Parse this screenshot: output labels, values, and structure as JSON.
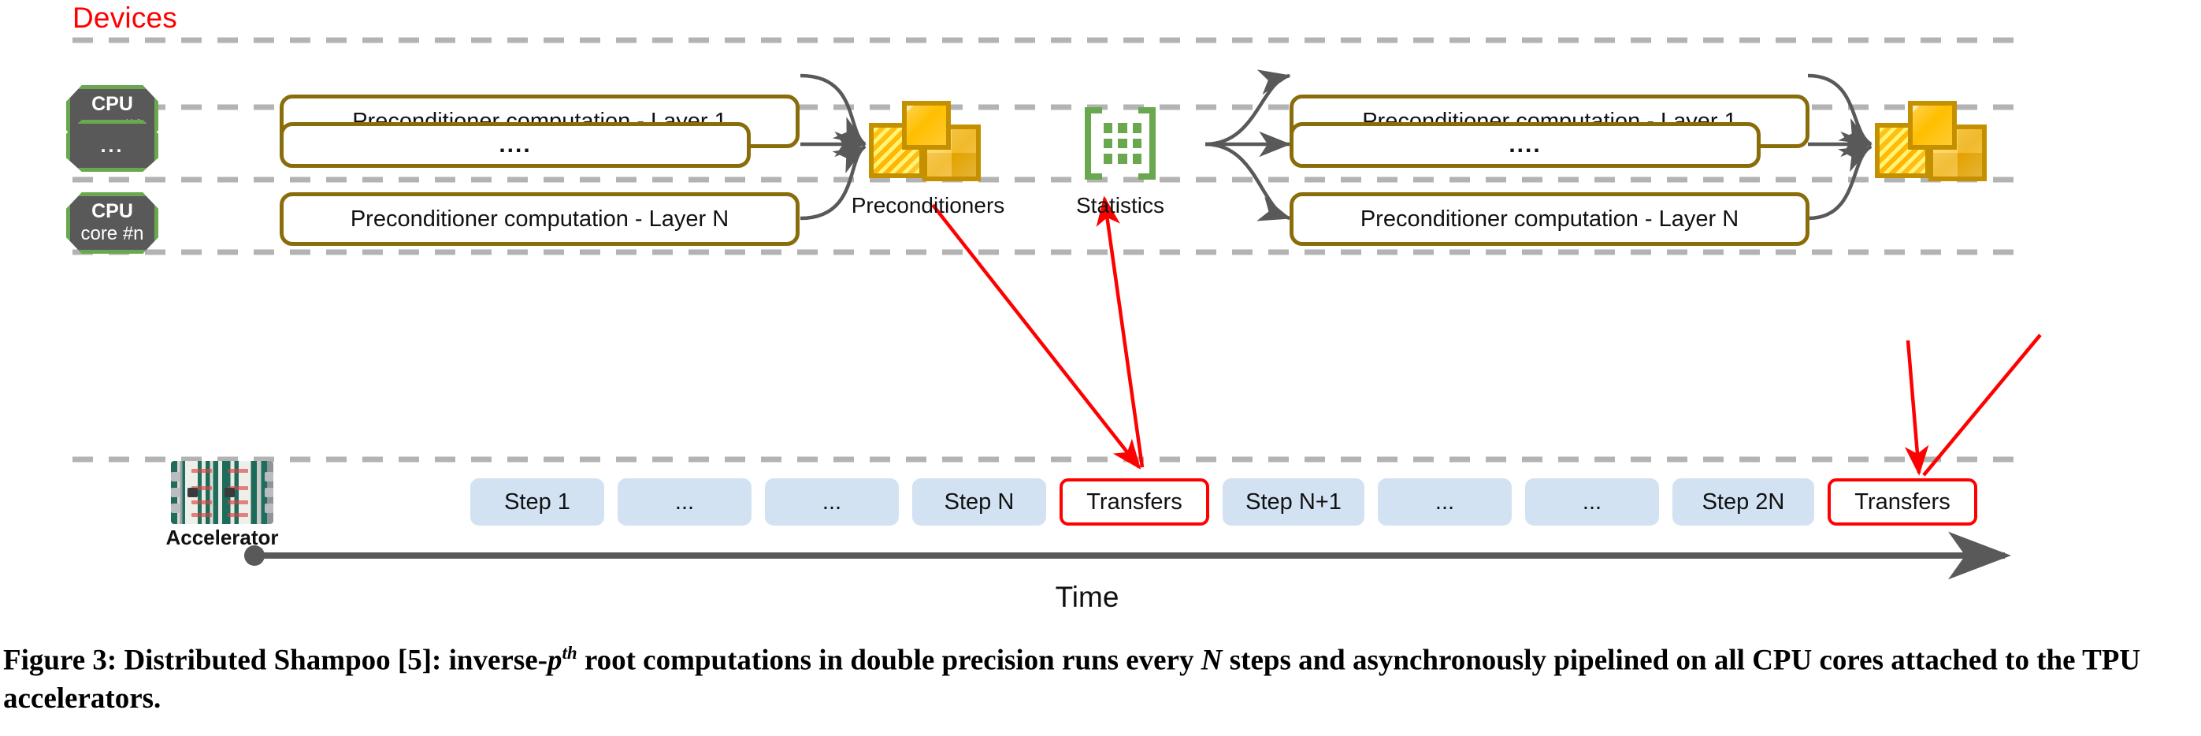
{
  "figure": {
    "devices_label": "Devices",
    "time_axis_label": "Time",
    "caption": {
      "prefix": "Figure 3: Distributed Shampoo [5]: inverse-",
      "math_p": "p",
      "math_sup": "th",
      "mid": " root computations in double precision runs every ",
      "math_N": "N",
      "suffix": " steps and asynchronously pipelined on all CPU cores attached to the TPU accelerators."
    }
  },
  "devices": [
    {
      "name": "cpu-core-1",
      "line1": "CPU",
      "line2": "core #1"
    },
    {
      "name": "cpu-core-mid",
      "line1": "...",
      "line2": ""
    },
    {
      "name": "cpu-core-n",
      "line1": "CPU",
      "line2": "core #n"
    }
  ],
  "accelerator": {
    "label": "Accelerator"
  },
  "stage_left": {
    "boxes": [
      "Preconditioner computation - Layer 1",
      "....",
      "Preconditioner computation - Layer N"
    ]
  },
  "stage_right": {
    "boxes": [
      "Preconditioner computation - Layer 1",
      "....",
      "Preconditioner computation - Layer N"
    ]
  },
  "icons": {
    "preconditioners_label": "Preconditioners",
    "statistics_label": "Statistics"
  },
  "timeline": {
    "steps": [
      {
        "label": "Step 1",
        "type": "step"
      },
      {
        "label": "...",
        "type": "step"
      },
      {
        "label": "...",
        "type": "step"
      },
      {
        "label": "Step N",
        "type": "step"
      },
      {
        "label": "Transfers",
        "type": "transfer"
      },
      {
        "label": "Step N+1",
        "type": "step"
      },
      {
        "label": "...",
        "type": "step"
      },
      {
        "label": "...",
        "type": "step"
      },
      {
        "label": "Step 2N",
        "type": "step"
      },
      {
        "label": "Transfers",
        "type": "transfer"
      }
    ]
  },
  "colors": {
    "devices_text": "#ff0000",
    "node_fill": "#595959",
    "node_border": "#6aa84f",
    "box_border": "#8a6d0b",
    "step_fill": "#d3e2f2",
    "transfer_border": "#ff0000",
    "arrow_gray": "#595959",
    "dash_gray": "#b3b3b3",
    "matrix_gold": "#ffc20a",
    "stats_green": "#6aa84f"
  }
}
